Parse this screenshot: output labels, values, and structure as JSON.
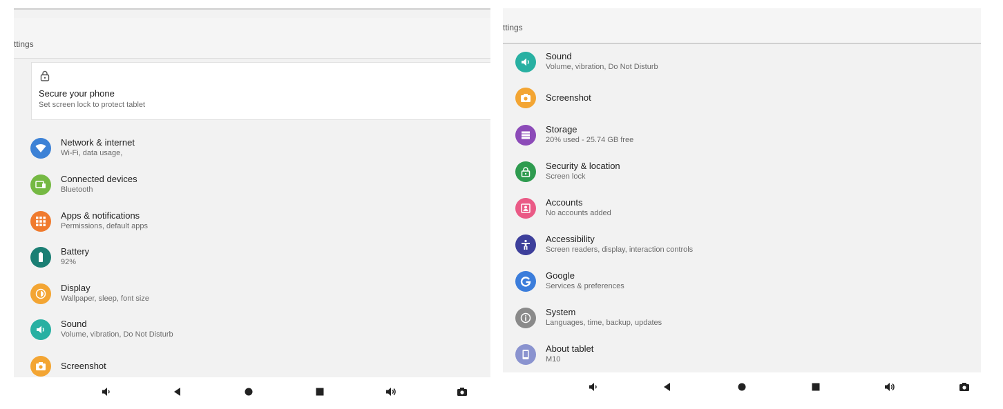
{
  "left_panel": {
    "title": "ttings",
    "suggestion": {
      "title": "Secure your phone",
      "subtitle": "Set screen lock to protect tablet",
      "icon": "lock-icon"
    },
    "items": [
      {
        "label": "Network & internet",
        "sub": "Wi-Fi, data usage,",
        "icon": "wifi-icon",
        "color": "#3d82d6"
      },
      {
        "label": "Connected devices",
        "sub": "Bluetooth",
        "icon": "devices-icon",
        "color": "#75b943"
      },
      {
        "label": "Apps & notifications",
        "sub": "Permissions, default apps",
        "icon": "apps-icon",
        "color": "#f07b2e"
      },
      {
        "label": "Battery",
        "sub": "92%",
        "icon": "battery-icon",
        "color": "#1b7f74"
      },
      {
        "label": "Display",
        "sub": "Wallpaper, sleep, font size",
        "icon": "brightness-icon",
        "color": "#f3a533"
      },
      {
        "label": "Sound",
        "sub": "Volume, vibration, Do Not Disturb",
        "icon": "volume-icon",
        "color": "#28b0a2"
      },
      {
        "label": "Screenshot",
        "sub": "",
        "icon": "camera-icon",
        "color": "#f3a533"
      }
    ]
  },
  "right_panel": {
    "title": "ttings",
    "items": [
      {
        "label": "Sound",
        "sub": "Volume, vibration, Do Not Disturb",
        "icon": "volume-icon",
        "color": "#28b0a2"
      },
      {
        "label": "Screenshot",
        "sub": "",
        "icon": "camera-icon",
        "color": "#f3a533"
      },
      {
        "label": "Storage",
        "sub": "20% used - 25.74 GB free",
        "icon": "storage-icon",
        "color": "#8c4bb8"
      },
      {
        "label": "Security & location",
        "sub": "Screen lock",
        "icon": "lock-icon",
        "color": "#2e9b4f"
      },
      {
        "label": "Accounts",
        "sub": "No accounts added",
        "icon": "account-icon",
        "color": "#ea5a86"
      },
      {
        "label": "Accessibility",
        "sub": "Screen readers, display, interaction controls",
        "icon": "accessibility-icon",
        "color": "#3d3f9b"
      },
      {
        "label": "Google",
        "sub": "Services & preferences",
        "icon": "google-icon",
        "color": "#3b7ddb"
      },
      {
        "label": "System",
        "sub": "Languages, time, backup, updates",
        "icon": "info-icon",
        "color": "#8a8a8a"
      },
      {
        "label": "About tablet",
        "sub": "M10",
        "icon": "tablet-icon",
        "color": "#8a93cf"
      }
    ]
  },
  "navbar": [
    "volume-down-icon",
    "back-icon",
    "home-icon",
    "recents-icon",
    "volume-up-icon",
    "screenshot-icon"
  ]
}
